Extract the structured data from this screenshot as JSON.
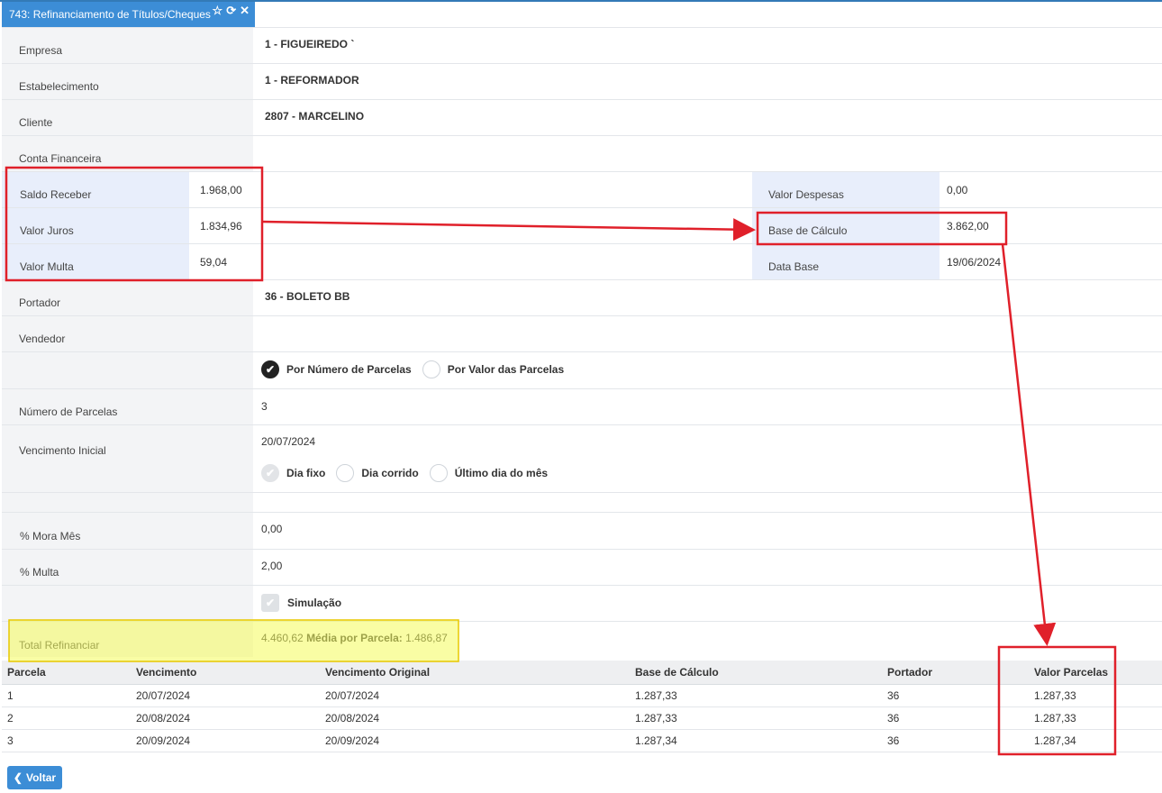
{
  "tab": {
    "title": "743: Refinanciamento de Títulos/Cheques"
  },
  "fields": {
    "empresa": {
      "label": "Empresa",
      "value": "1 - FIGUEIREDO `"
    },
    "estabelecimento": {
      "label": "Estabelecimento",
      "value": "1 - REFORMADOR"
    },
    "cliente": {
      "label": "Cliente",
      "value": "2807 - MARCELINO"
    },
    "conta": {
      "label": "Conta Financeira",
      "value": ""
    },
    "saldo": {
      "label": "Saldo Receber",
      "value": "1.968,00"
    },
    "juros": {
      "label": "Valor Juros",
      "value": "1.834,96"
    },
    "multa": {
      "label": "Valor Multa",
      "value": "59,04"
    },
    "despesas": {
      "label": "Valor Despesas",
      "value": "0,00"
    },
    "base": {
      "label": "Base de Cálculo",
      "value": "3.862,00"
    },
    "data_base": {
      "label": "Data Base",
      "value": "19/06/2024"
    },
    "portador": {
      "label": "Portador",
      "value": "36 - BOLETO BB"
    },
    "vendedor": {
      "label": "Vendedor",
      "value": ""
    },
    "modo": {
      "opt1": "Por Número de Parcelas",
      "opt2": "Por Valor das Parcelas"
    },
    "num_parcelas": {
      "label": "Número de Parcelas",
      "value": "3"
    },
    "venc": {
      "label": "Vencimento Inicial",
      "value": "20/07/2024",
      "opt1": "Dia fixo",
      "opt2": "Dia corrido",
      "opt3": "Último dia do mês"
    },
    "mora": {
      "label": "% Mora Mês",
      "value": "0,00"
    },
    "pmulta": {
      "label": "% Multa",
      "value": "2,00"
    },
    "simulacao": {
      "label": "Simulação"
    },
    "total": {
      "label": "Total Refinanciar",
      "value": "4.460,62",
      "media_label": "Média por Parcela:",
      "media_value": "1.486,87"
    }
  },
  "grid": {
    "headers": [
      "Parcela",
      "Vencimento",
      "Vencimento Original",
      "Base de Cálculo",
      "Portador",
      "Valor Parcelas"
    ],
    "rows": [
      [
        "1",
        "20/07/2024",
        "20/07/2024",
        "1.287,33",
        "36",
        "1.287,33"
      ],
      [
        "2",
        "20/08/2024",
        "20/08/2024",
        "1.287,33",
        "36",
        "1.287,33"
      ],
      [
        "3",
        "20/09/2024",
        "20/09/2024",
        "1.287,34",
        "36",
        "1.287,34"
      ]
    ]
  },
  "buttons": {
    "back": "Voltar"
  },
  "colors": {
    "accent": "#3c8dd6",
    "annotation_red": "#e0202a",
    "highlight": "#f4fb5a"
  }
}
